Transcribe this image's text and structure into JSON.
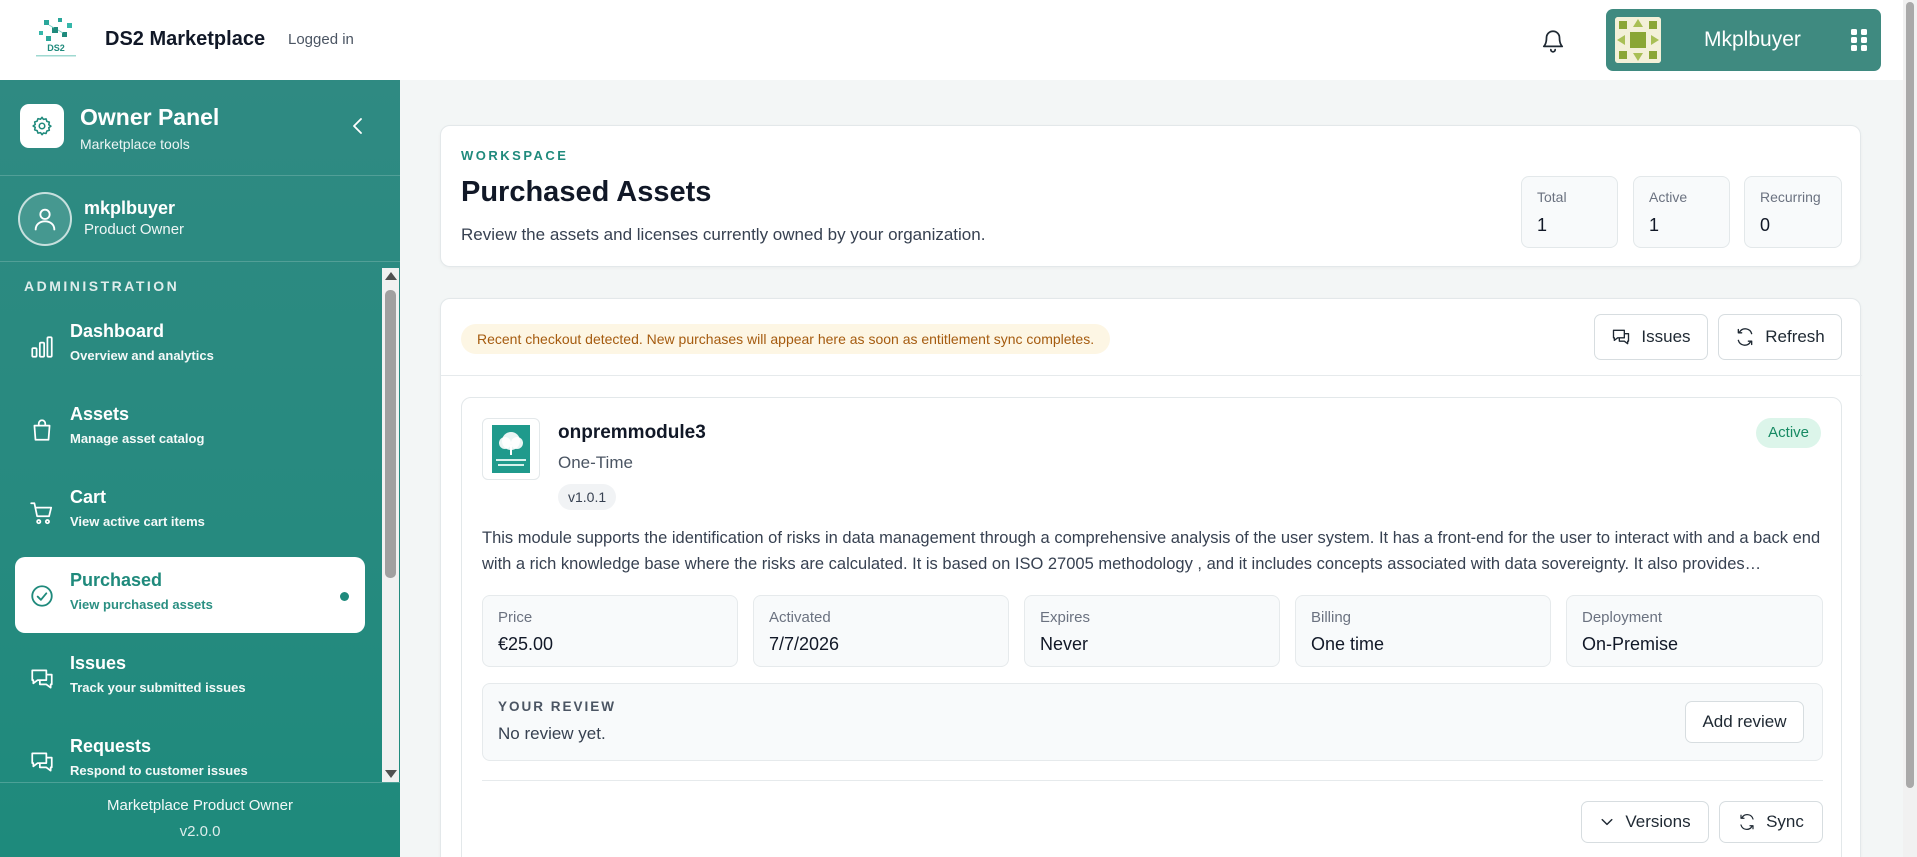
{
  "app": {
    "title": "DS2 Marketplace",
    "login_status": "Logged in",
    "logo_text": "DS2"
  },
  "user_chip": {
    "name": "Mkplbuyer"
  },
  "sidebar": {
    "panel_title": "Owner Panel",
    "panel_subtitle": "Marketplace tools",
    "profile_name": "mkplbuyer",
    "profile_role": "Product Owner",
    "section_label": "ADMINISTRATION",
    "items": [
      {
        "title": "Dashboard",
        "subtitle": "Overview and analytics",
        "icon": "chart-bars-icon"
      },
      {
        "title": "Assets",
        "subtitle": "Manage asset catalog",
        "icon": "shopping-bag-icon"
      },
      {
        "title": "Cart",
        "subtitle": "View active cart items",
        "icon": "cart-icon"
      },
      {
        "title": "Purchased",
        "subtitle": "View purchased assets",
        "icon": "check-circle-icon",
        "active": true
      },
      {
        "title": "Issues",
        "subtitle": "Track your submitted issues",
        "icon": "chat-bubbles-icon"
      },
      {
        "title": "Requests",
        "subtitle": "Respond to customer issues",
        "icon": "chat-bubbles-icon"
      }
    ],
    "footer_role": "Marketplace Product Owner",
    "footer_version": "v2.0.0"
  },
  "hero": {
    "eyebrow": "WORKSPACE",
    "title": "Purchased Assets",
    "description": "Review the assets and licenses currently owned by your organization.",
    "stats": [
      {
        "label": "Total",
        "value": "1"
      },
      {
        "label": "Active",
        "value": "1"
      },
      {
        "label": "Recurring",
        "value": "0"
      }
    ]
  },
  "list": {
    "notice": "Recent checkout detected. New purchases will appear here as soon as entitlement sync completes.",
    "issues_label": "Issues",
    "refresh_label": "Refresh"
  },
  "asset": {
    "name": "onpremmodule3",
    "type": "One-Time",
    "version": "v1.0.1",
    "status": "Active",
    "description": "This module supports the identification of risks in data management through a comprehensive analysis of the user system. It has a front-end for the user to interact with and a back end with a rich knowledge base where the risks are calculated. It is based on ISO 27005 methodology , and it includes concepts associated with data sovereignty. It also provides recommendations.",
    "meta": [
      {
        "label": "Price",
        "value": "€25.00"
      },
      {
        "label": "Activated",
        "value": "7/7/2026"
      },
      {
        "label": "Expires",
        "value": "Never"
      },
      {
        "label": "Billing",
        "value": "One time"
      },
      {
        "label": "Deployment",
        "value": "On-Premise"
      }
    ],
    "review_label": "YOUR REVIEW",
    "review_value": "No review yet.",
    "add_review_label": "Add review",
    "versions_label": "Versions",
    "sync_label": "Sync"
  },
  "colors": {
    "brand": "#1f8a7c",
    "sidebar": "#268a7f",
    "user_chip": "#3f8a80",
    "active_badge": "#168a63",
    "notice_text": "#a55b0f"
  }
}
